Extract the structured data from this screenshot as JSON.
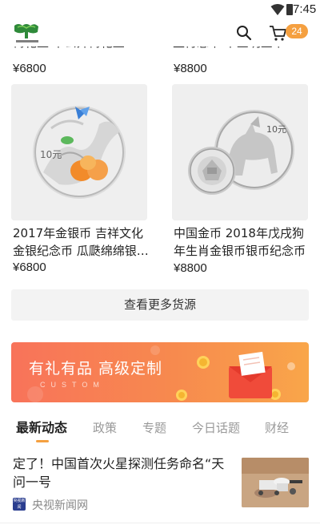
{
  "status_bar": {
    "time": "7:45"
  },
  "header": {
    "cart_count": "24"
  },
  "partial_row": {
    "left_title_fragment": "梅花玉 下公开梅花玉",
    "right_title_fragment": "生肖总币 下金明金币",
    "left_price": "¥6800",
    "right_price": "¥8800"
  },
  "products": [
    {
      "title": "2017年金银币 吉祥文化金银纪念币 瓜瓞绵绵银…",
      "price": "¥6800",
      "coin_label": "10元"
    },
    {
      "title": "中国金币 2018年戊戌狗年生肖金银币银币纪念币",
      "price": "¥8800",
      "coin_label": "10元"
    }
  ],
  "more_button": {
    "label": "查看更多货源"
  },
  "banner": {
    "title": "有礼有品 高级定制",
    "subtitle": "CUSTOM"
  },
  "tabs": [
    {
      "label": "最新动态"
    },
    {
      "label": "政策"
    },
    {
      "label": "专题"
    },
    {
      "label": "今日话题"
    },
    {
      "label": "财经"
    }
  ],
  "news": {
    "title": "定了！中国首次火星探测任务命名“天问一号",
    "source": "央视新闻网",
    "source_icon_text": "央视新闻"
  },
  "colors": {
    "accent": "#f5a040",
    "banner_start": "#f8735a",
    "banner_end": "#f9a64a"
  }
}
